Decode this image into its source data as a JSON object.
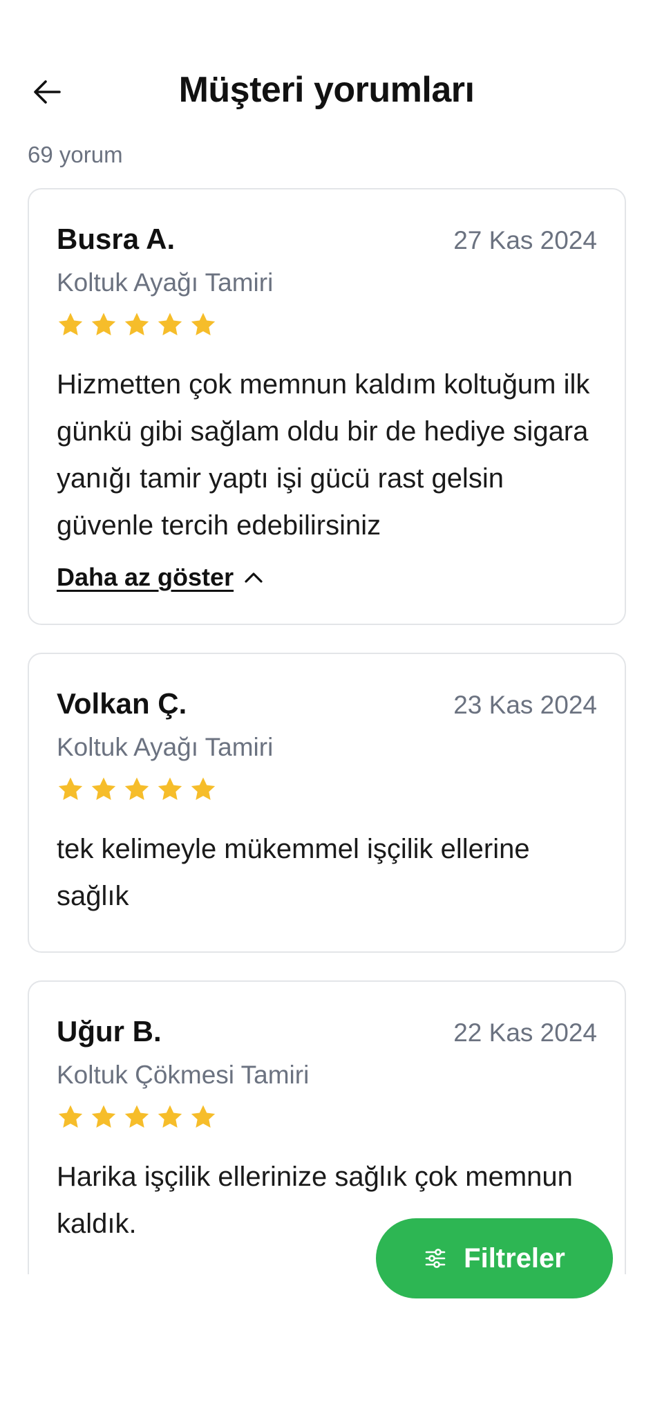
{
  "header": {
    "title": "Müşteri yorumları",
    "review_count": "69 yorum"
  },
  "reviews": [
    {
      "name": "Busra A.",
      "date": "27 Kas 2024",
      "service": "Koltuk Ayağı Tamiri",
      "rating": 5,
      "comment": "Hizmetten çok memnun kaldım koltuğum ilk günkü gibi sağlam oldu bir de hediye sigara yanığı tamir yaptı işi gücü rast gelsin güvenle tercih edebilirsiniz",
      "toggle_label": "Daha az göster"
    },
    {
      "name": "Volkan Ç.",
      "date": "23 Kas 2024",
      "service": "Koltuk Ayağı Tamiri",
      "rating": 5,
      "comment": "tek kelimeyle mükemmel işçilik ellerine sağlık"
    },
    {
      "name": "Uğur B.",
      "date": "22 Kas 2024",
      "service": "Koltuk Çökmesi Tamiri",
      "rating": 5,
      "comment": "Harika işçilik ellerinize sağlık çok memnun kaldık."
    }
  ],
  "filter_button": {
    "label": "Filtreler"
  },
  "colors": {
    "star": "#f6bd2a",
    "accent": "#2db653",
    "muted_text": "#6b7280",
    "card_border": "#e3e5e8"
  },
  "icons": {
    "back": "arrow-left-icon",
    "star": "star-icon",
    "collapse": "chevron-up-icon",
    "filter": "sliders-icon"
  }
}
